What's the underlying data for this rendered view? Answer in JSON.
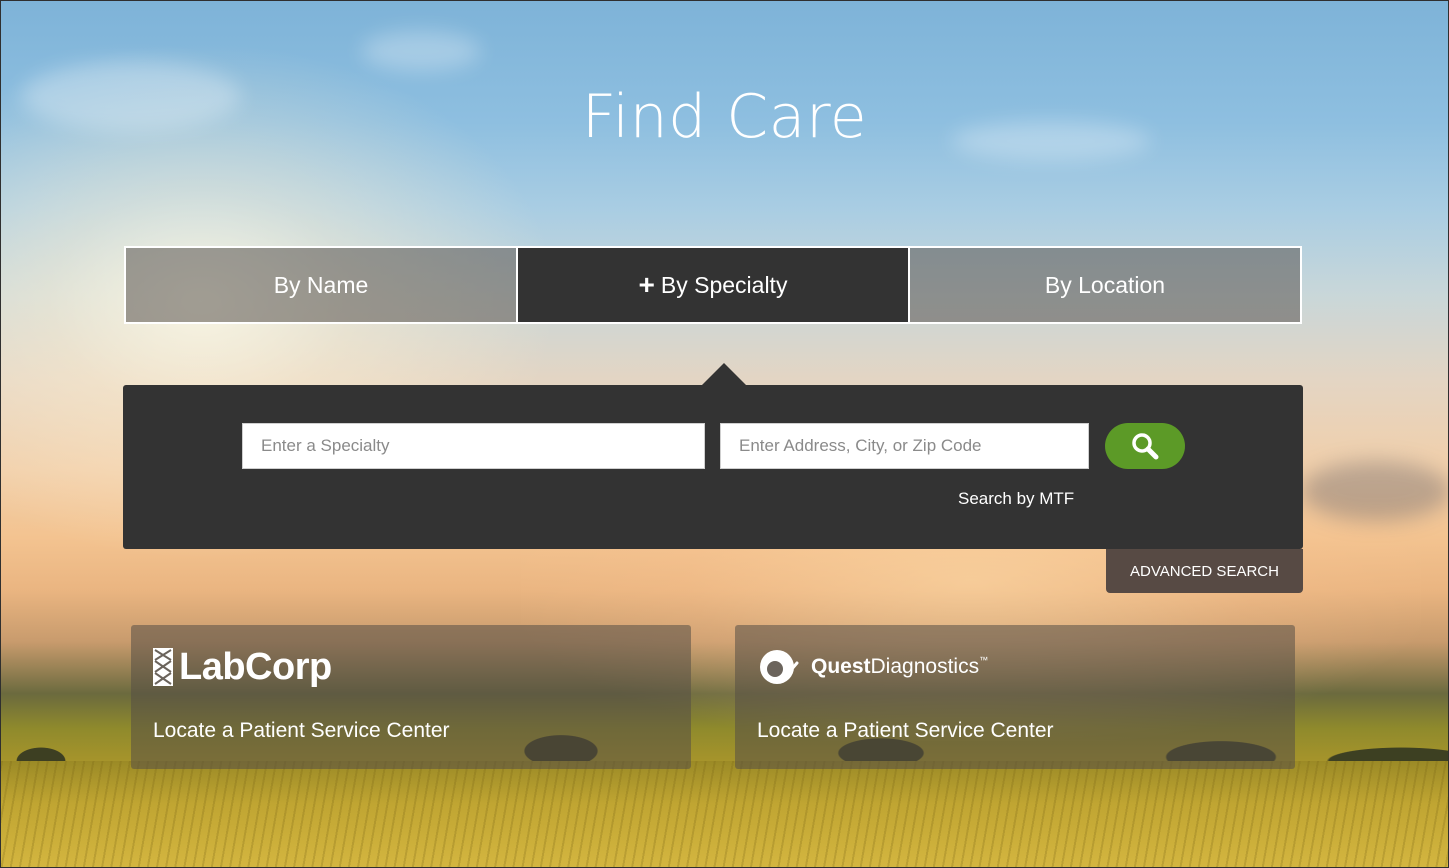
{
  "page": {
    "title": "Find Care"
  },
  "tabs": [
    {
      "label": "By Name",
      "active": false
    },
    {
      "label": "By Specialty",
      "active": true,
      "icon": "plus-icon"
    },
    {
      "label": "By Location",
      "active": false
    }
  ],
  "search": {
    "specialty_placeholder": "Enter a Specialty",
    "specialty_value": "",
    "address_placeholder": "Enter Address, City, or Zip Code",
    "address_value": "",
    "button_icon": "search-icon",
    "mtf_link": "Search by MTF",
    "advanced_label": "ADVANCED SEARCH"
  },
  "labs": [
    {
      "logo_text": "LabCorp",
      "link": "Locate a Patient Service Center"
    },
    {
      "logo_text": "Quest Diagnostics",
      "logo_text_bold": "Quest",
      "logo_text_light": "Diagnostics",
      "logo_mark": "™",
      "link": "Locate a Patient Service Center"
    }
  ],
  "colors": {
    "panel": "#333333",
    "search_button": "#5c9a27",
    "advanced_button": "#574a44"
  }
}
